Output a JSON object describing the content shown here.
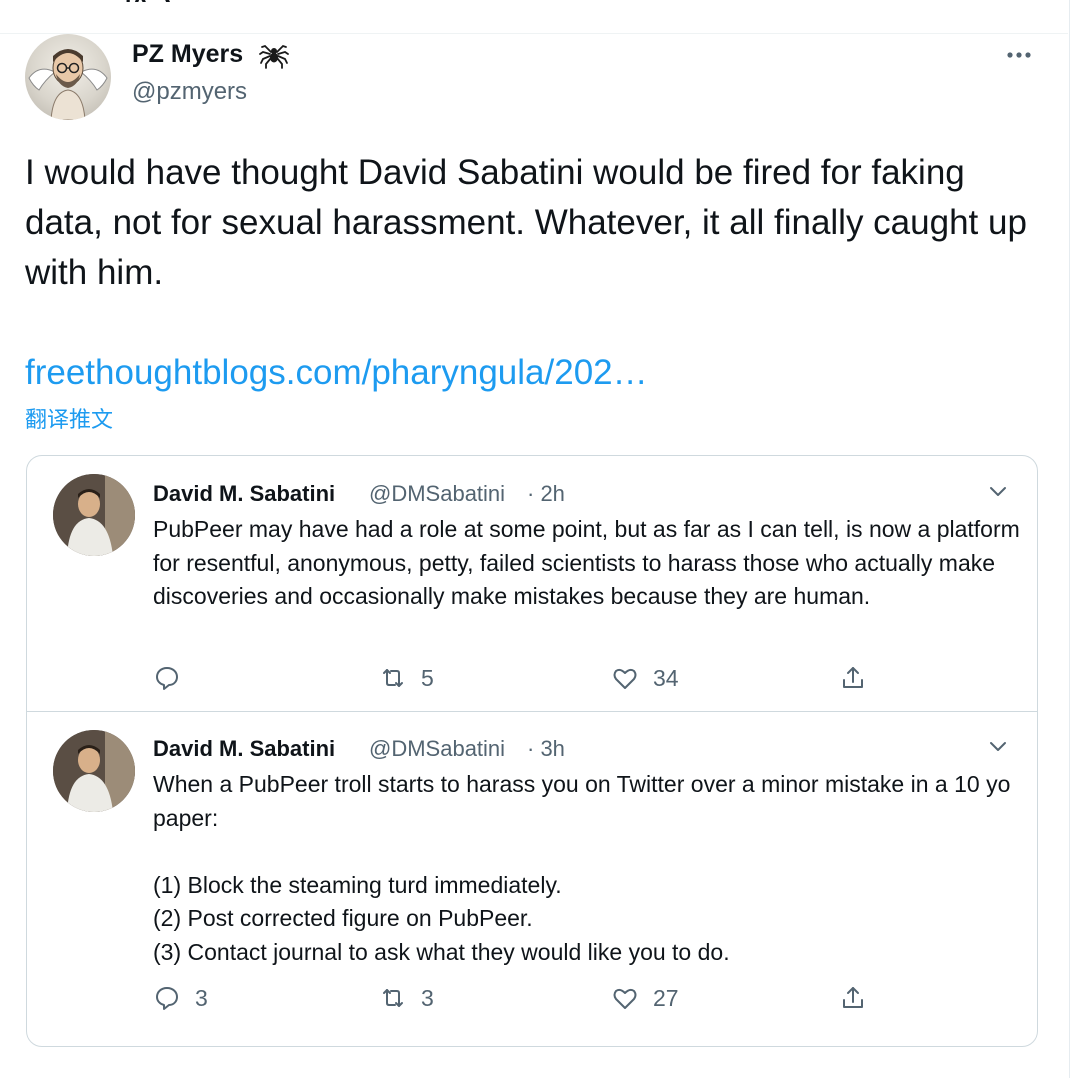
{
  "header": {
    "partial_title": "推文"
  },
  "tweet": {
    "author": {
      "name": "PZ Myers",
      "handle": "@pzmyers"
    },
    "text": "I would have thought David Sabatini would be fired for faking data, not for sexual harassment. Whatever, it all finally caught up with him.",
    "link": "freethoughtblogs.com/pharyngula/202…",
    "translate_label": "翻译推文"
  },
  "quoted_tweets": [
    {
      "name": "David M. Sabatini",
      "handle": "@DMSabatini",
      "time": "· 2h",
      "text": "PubPeer may have had a role at some point, but as far as I can tell, is now a platform for resentful, anonymous, petty, failed scientists to harass those who actually make discoveries and occasionally make mistakes because they are human.",
      "reply_count": "",
      "retweet_count": "5",
      "like_count": "34"
    },
    {
      "name": "David M. Sabatini",
      "handle": "@DMSabatini",
      "time": "· 3h",
      "text": "When a PubPeer troll starts to harass you on Twitter over a minor mistake in a 10 yo paper:\n\n(1) Block the steaming turd immediately.\n(2) Post corrected figure on PubPeer.\n(3) Contact journal to ask what they would like you to do.",
      "reply_count": "3",
      "retweet_count": "3",
      "like_count": "27"
    }
  ],
  "icons": {
    "spider": "spider-icon",
    "more": "more-horizontal-icon",
    "chevron": "chevron-down-icon",
    "reply": "reply-icon",
    "retweet": "retweet-icon",
    "like": "heart-icon",
    "share": "share-icon"
  },
  "colors": {
    "link": "#1d9bf0",
    "secondary_text": "#536471",
    "border": "#cfd9de"
  }
}
